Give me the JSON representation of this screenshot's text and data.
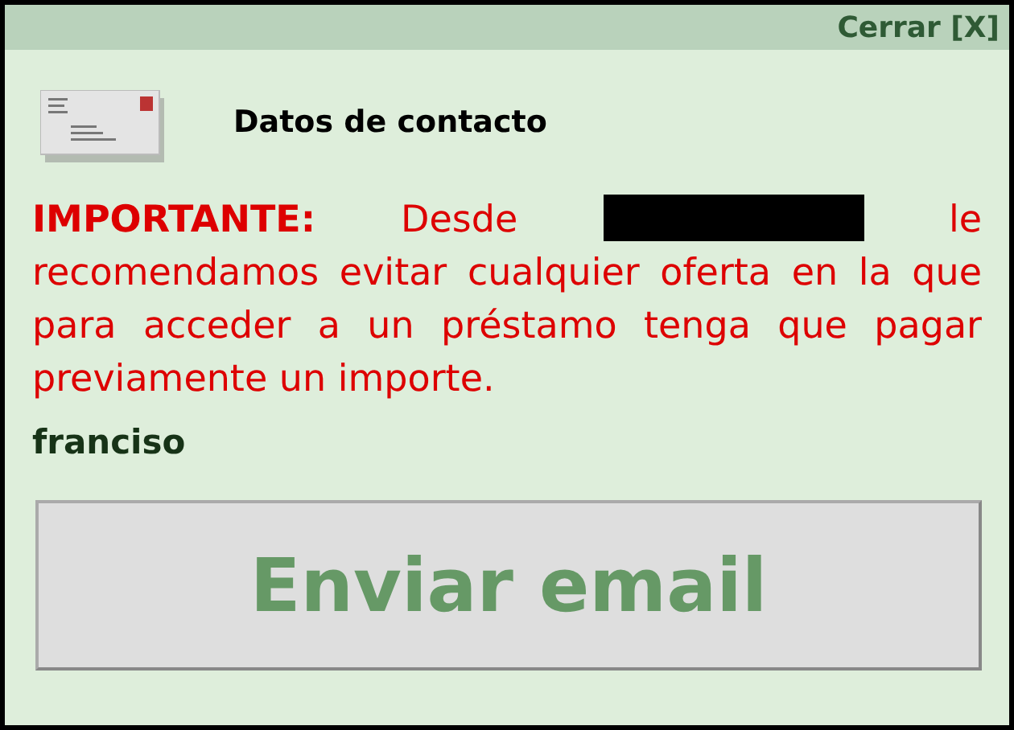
{
  "close_link": "Cerrar [X]",
  "title": "Datos de contacto",
  "notice": {
    "text_before": "**IMPORTANTE:** Desde",
    "redacted": true,
    "text_after": "le recomendamos evitar cualquier oferta en la que para acceder a un préstamo tenga que pagar previamente un importe."
  },
  "name": "franciso",
  "send_button": "Enviar email"
}
